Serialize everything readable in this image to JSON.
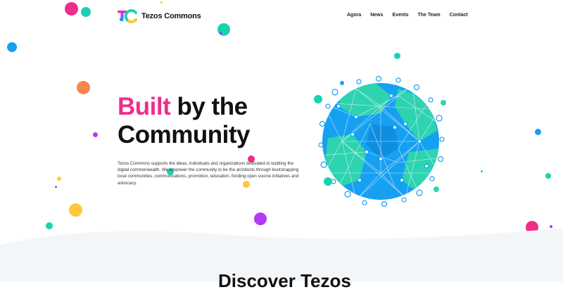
{
  "brand": {
    "logo_name": "tezos-commons-logo",
    "name": "Tezos Commons"
  },
  "nav": {
    "items": [
      "Agora",
      "News",
      "Events",
      "The Team",
      "Contact"
    ]
  },
  "hero": {
    "title_accent": "Built",
    "title_rest_line1": " by the",
    "title_line2": "Community",
    "description": "Tezos Commons supports the ideas, individuals and organizations dedicated to building the digital commonwealth. We empower the community to be the architects through bootstrapping local communities, communications, promotion, education, funding open source initiatives and advocacy.",
    "illustration": "globe-network-illustration"
  },
  "section": {
    "discover_title": "Discover Tezos"
  },
  "colors": {
    "accent_pink": "#ee2e8a",
    "teal": "#19d3b0",
    "blue": "#16a0f2",
    "orange": "#f5874e",
    "yellow": "#fdc93b",
    "purple": "#b23af5",
    "wave_bg": "#f3f6f9"
  }
}
